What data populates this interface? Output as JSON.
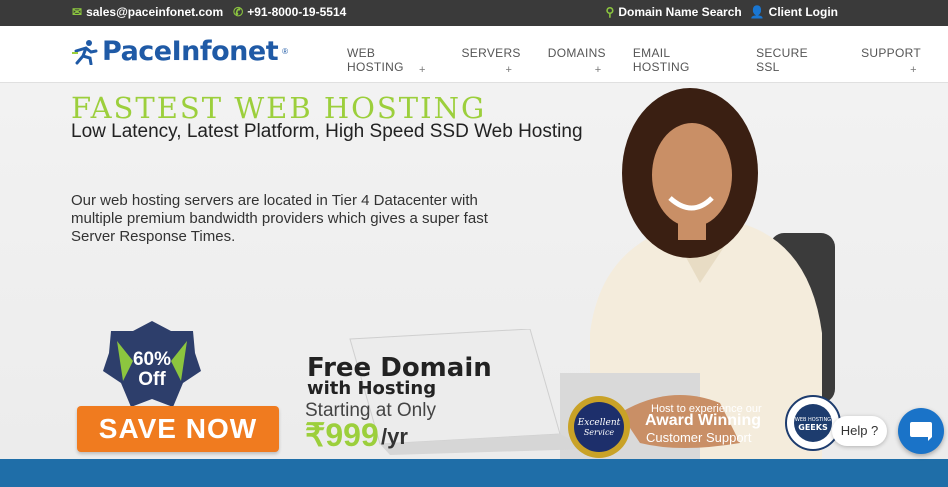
{
  "topbar": {
    "email": "sales@paceinfonet.com",
    "phone": "+91-8000-19-5514",
    "domain_search": "Domain Name Search",
    "client_login": "Client Login"
  },
  "header": {
    "logo_text": "PaceInfonet",
    "logo_reg": "®",
    "nav": [
      {
        "label": "WEB HOSTING"
      },
      {
        "label": "SERVERS"
      },
      {
        "label": "DOMAINS"
      },
      {
        "label": "EMAIL HOSTING"
      },
      {
        "label": "SECURE SSL"
      },
      {
        "label": "SUPPORT"
      }
    ]
  },
  "hero": {
    "title": "FASTEST WEB HOSTING",
    "subtitle": "Low Latency, Latest Platform, High Speed SSD Web Hosting",
    "description": "Our web hosting servers are located in Tier 4 Datacenter with multiple premium bandwidth providers which gives a super fast Server Response Times.",
    "badge_line1": "60%",
    "badge_line2": "Off",
    "save_now": "SAVE NOW",
    "free_domain": "Free Domain",
    "with_hosting": "with Hosting",
    "starting": "Starting at Only",
    "price": "₹999",
    "per": "/yr",
    "seal1_line1": "Excellent",
    "seal1_line2": "Service",
    "award_small": "Host to experience our",
    "award_big": "Award Winning",
    "award_cust": "Customer Support",
    "seal2_line1": "WEB HOSTING",
    "seal2_line2": "GEEKS"
  },
  "chat": {
    "help_label": "Help ?"
  },
  "colors": {
    "accent_green": "#9ccf3c",
    "brand_blue": "#1f5aa6",
    "orange": "#f07b1f",
    "topbar": "#3a3a3a"
  }
}
